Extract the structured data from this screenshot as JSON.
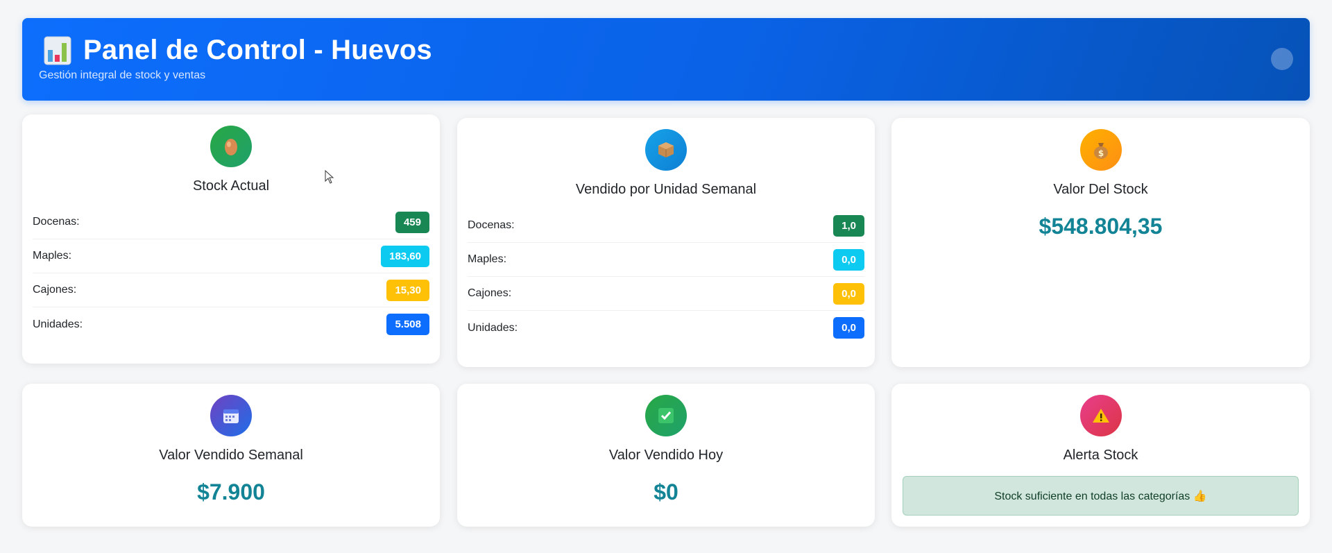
{
  "header": {
    "title": "Panel de Control - Huevos",
    "subtitle": "Gestión integral de stock y ventas",
    "icon": "bar-chart-icon"
  },
  "stock_actual": {
    "title": "Stock Actual",
    "icon": "egg-icon",
    "rows": [
      {
        "label": "Docenas:",
        "value": "459",
        "color": "#198754"
      },
      {
        "label": "Maples:",
        "value": "183,60",
        "color": "#0dcaf0"
      },
      {
        "label": "Cajones:",
        "value": "15,30",
        "color": "#ffc107"
      },
      {
        "label": "Unidades:",
        "value": "5.508",
        "color": "#0d6efd"
      }
    ]
  },
  "vendido_semanal": {
    "title": "Vendido por Unidad Semanal",
    "icon": "package-icon",
    "rows": [
      {
        "label": "Docenas:",
        "value": "1,0",
        "color": "#198754"
      },
      {
        "label": "Maples:",
        "value": "0,0",
        "color": "#0dcaf0"
      },
      {
        "label": "Cajones:",
        "value": "0,0",
        "color": "#ffc107"
      },
      {
        "label": "Unidades:",
        "value": "0,0",
        "color": "#0d6efd"
      }
    ]
  },
  "valor_stock": {
    "title": "Valor Del Stock",
    "icon": "money-bag-icon",
    "value": "$548.804,35"
  },
  "valor_vendido_semanal": {
    "title": "Valor Vendido Semanal",
    "icon": "calendar-icon",
    "value": "$7.900"
  },
  "valor_vendido_hoy": {
    "title": "Valor Vendido Hoy",
    "icon": "check-mark-icon",
    "value": "$0"
  },
  "alerta_stock": {
    "title": "Alerta Stock",
    "icon": "warning-icon",
    "message": "Stock suficiente en todas las categorías 👍"
  },
  "colors": {
    "header": "#0d6efd",
    "value_text": "#138496",
    "alert_bg": "#d1e7dd"
  }
}
